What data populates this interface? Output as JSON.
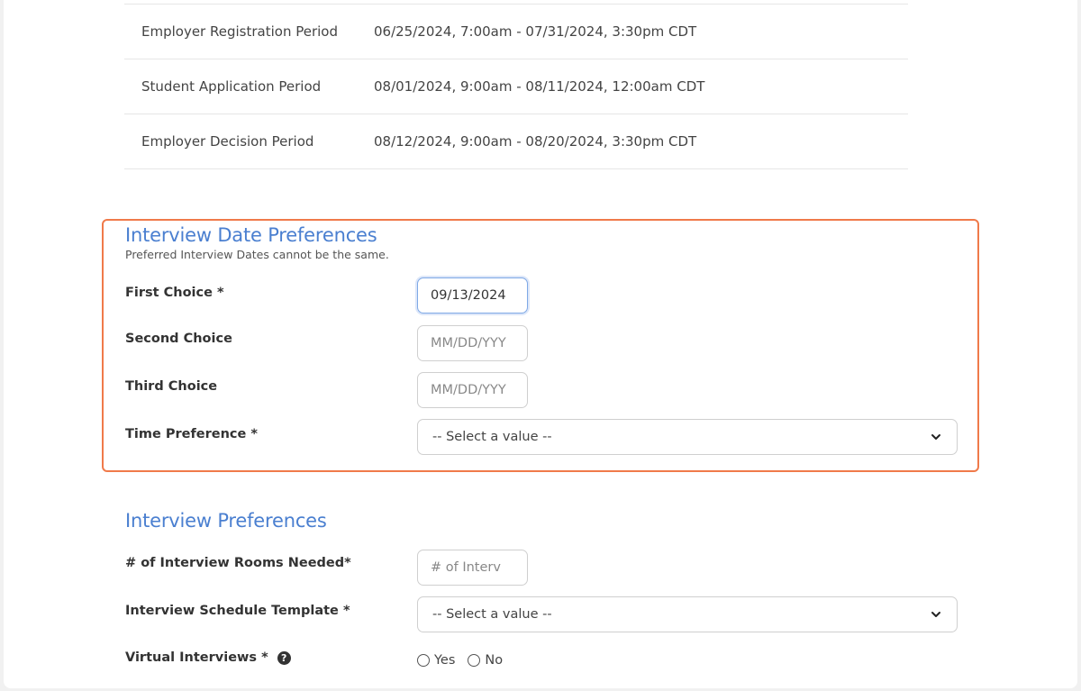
{
  "periods": [
    {
      "label": "Employer Registration Period",
      "value": "06/25/2024, 7:00am - 07/31/2024, 3:30pm CDT"
    },
    {
      "label": "Student Application Period",
      "value": "08/01/2024, 9:00am - 08/11/2024, 12:00am CDT"
    },
    {
      "label": "Employer Decision Period",
      "value": "08/12/2024, 9:00am - 08/20/2024, 3:30pm CDT"
    }
  ],
  "date_prefs": {
    "title": "Interview Date Preferences",
    "subtitle": "Preferred Interview Dates cannot be the same.",
    "first_label": "First Choice *",
    "first_value": "09/13/2024",
    "second_label": "Second Choice",
    "second_placeholder": "MM/DD/YYY",
    "third_label": "Third Choice",
    "third_placeholder": "MM/DD/YYY",
    "time_label": "Time Preference *",
    "time_value": "-- Select a value --"
  },
  "interview_prefs": {
    "title": "Interview Preferences",
    "rooms_label": "# of Interview Rooms Needed*",
    "rooms_placeholder": "# of Interv",
    "template_label": "Interview Schedule Template *",
    "template_value": "-- Select a value --",
    "virtual_label": "Virtual Interviews *",
    "help_glyph": "?",
    "yes_label": "Yes",
    "no_label": "No"
  },
  "colors": {
    "accent": "#4a7fd0",
    "highlight_border": "#f07a4a"
  },
  "icons": {
    "dropdown": "chevron-down-icon",
    "help": "question-circle-icon"
  }
}
